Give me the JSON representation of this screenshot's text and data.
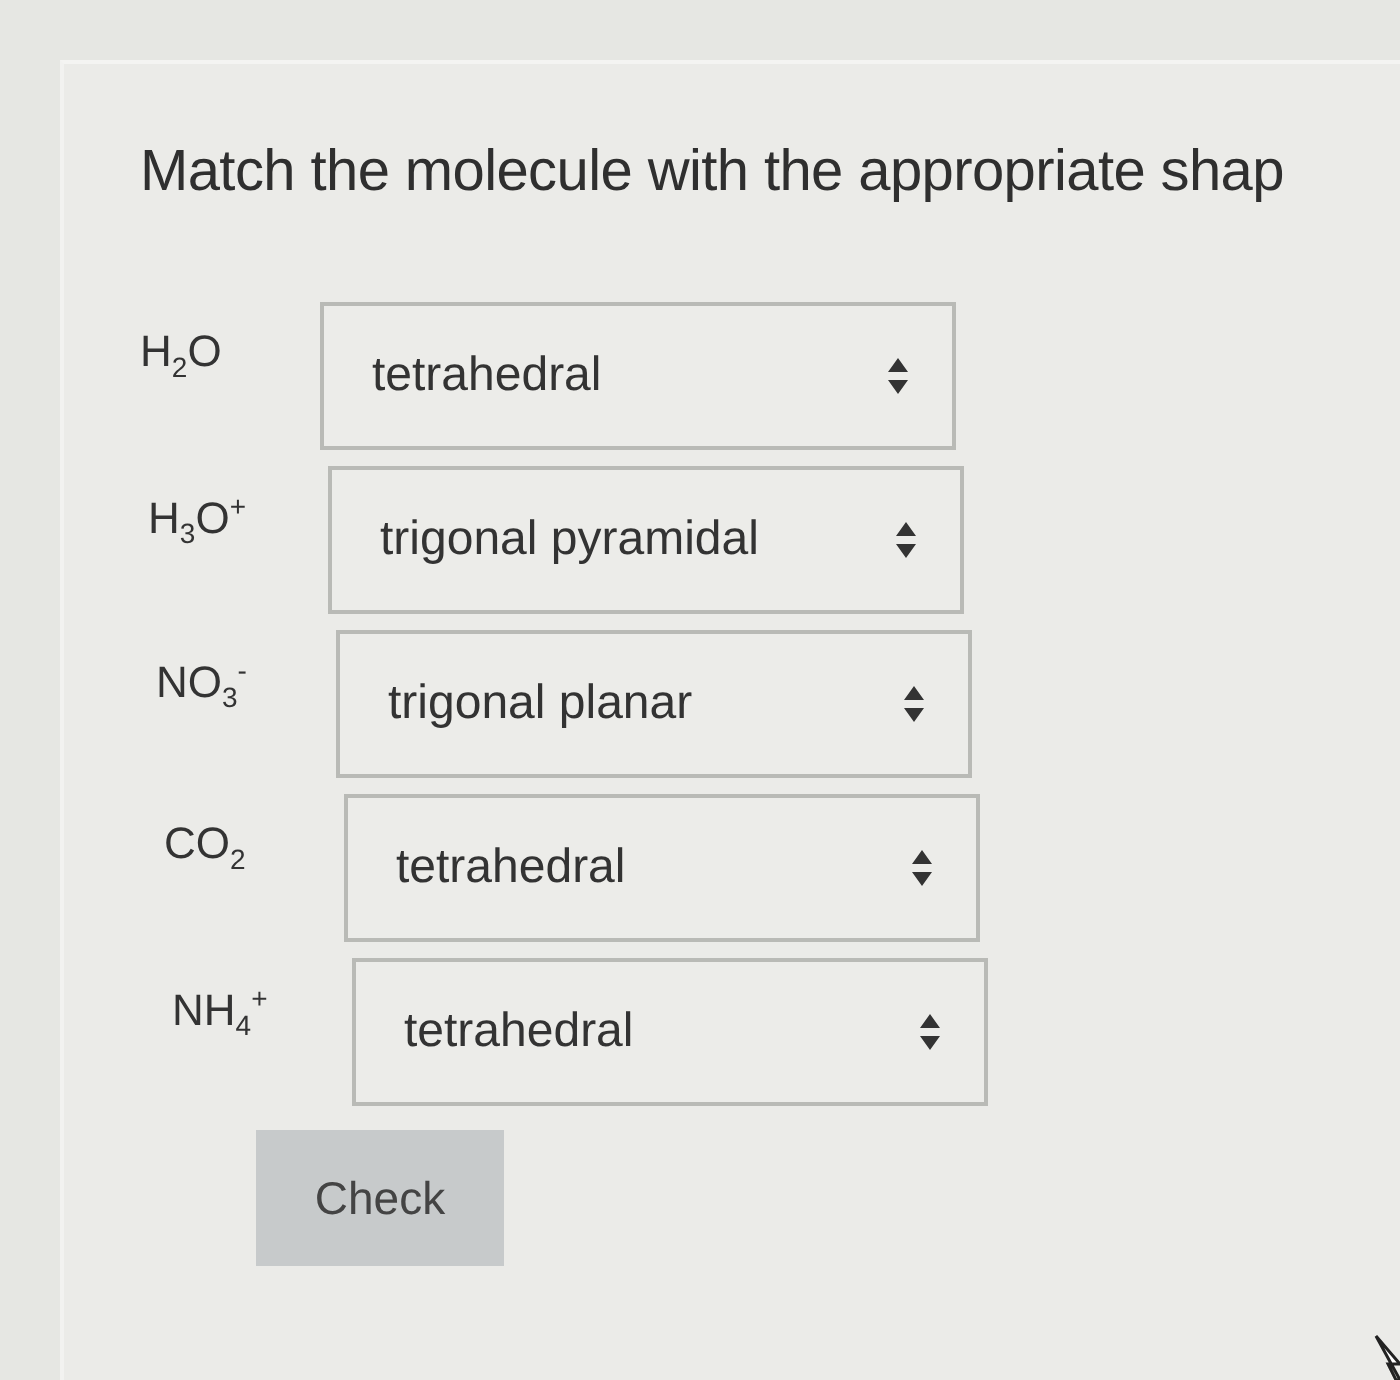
{
  "question": {
    "title": "Match the molecule with the appropriate shap"
  },
  "rows": [
    {
      "molecule": "H$_{2}$O",
      "shape": "tetrahedral"
    },
    {
      "molecule": "H$_{3}$O$^{+}$",
      "shape": "trigonal pyramidal"
    },
    {
      "molecule": "NO$_{3}$$^{-}$",
      "shape": "trigonal planar"
    },
    {
      "molecule": "CO$_{2}$",
      "shape": "tetrahedral"
    },
    {
      "molecule": "NH$_{4}$$^{+}$",
      "shape": "tetrahedral"
    }
  ],
  "check_button": {
    "label": "Check"
  }
}
